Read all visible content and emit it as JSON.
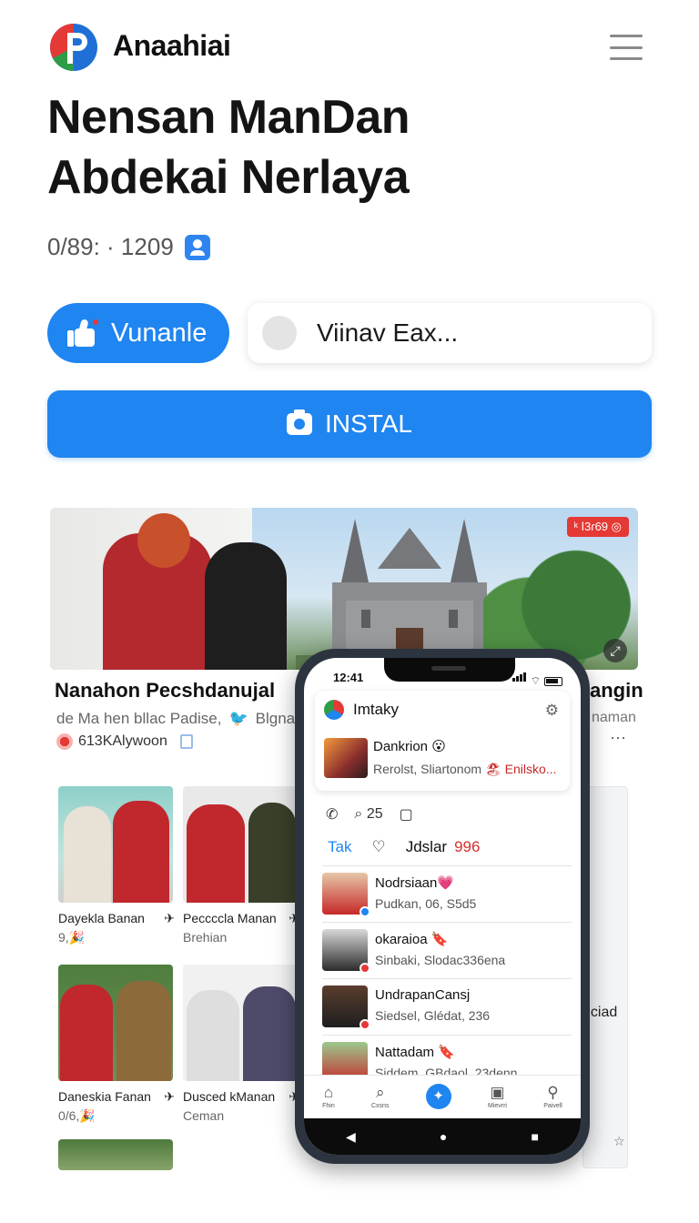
{
  "header": {
    "brand": "Anaahiai"
  },
  "headline": {
    "line1": "Nensan ManDan",
    "line2": "Abdekai Nerlaya"
  },
  "meta": {
    "text": "0/89: · 1209"
  },
  "actions": {
    "vote_label": "Vunanle",
    "search_value": "Viinav Eax...",
    "install_label": "INSTAL"
  },
  "hero": {
    "badge": "ᵏ ǀ3ɾ69 ◎"
  },
  "feed": {
    "title": "Nanahon Pecshdanujal",
    "subtitle": "de Ma hen bllac Padise,",
    "subtitle_tag": "Blgnan",
    "source": "613KAlywoon",
    "right_title": "angin",
    "right_sub": "naman",
    "right_more": "···"
  },
  "cards": [
    {
      "caption": "Dayekla Banan",
      "sub": "9,🎉"
    },
    {
      "caption": "Peccccla Manan",
      "sub": "Brehian"
    },
    {
      "caption": "Daneskia Fanan",
      "sub": "0/6,🎉"
    },
    {
      "caption": "Dusced kManan",
      "sub": "Ceman"
    }
  ],
  "side": {
    "text": "nciad"
  },
  "phone": {
    "time": "12:41",
    "app_name": "Imtaky",
    "post": {
      "name": "Dankrion 😮",
      "meta": "Rerolst, Sliartonom",
      "tag": "🏖 Enilsko..."
    },
    "actions": {
      "count": "25"
    },
    "tabs": {
      "tab1": "Tak",
      "tab2": "Jdslar",
      "count": "996"
    },
    "list": [
      {
        "name": "Nodrsiaan💗",
        "sub": "Pudkan, 06, S5d5"
      },
      {
        "name": "okaraioa 🔖",
        "sub": "Sinbaki, Slodac336ena"
      },
      {
        "name": "UndrapanCansj",
        "sub": "Siedsel, Glédat, 236"
      },
      {
        "name": "Nattadam 🔖",
        "sub": "Siddem, GBdaol, 23denn"
      }
    ],
    "nav": [
      "Fhin",
      "Cxsns",
      "",
      "Mievrri",
      "Paivell"
    ]
  }
}
